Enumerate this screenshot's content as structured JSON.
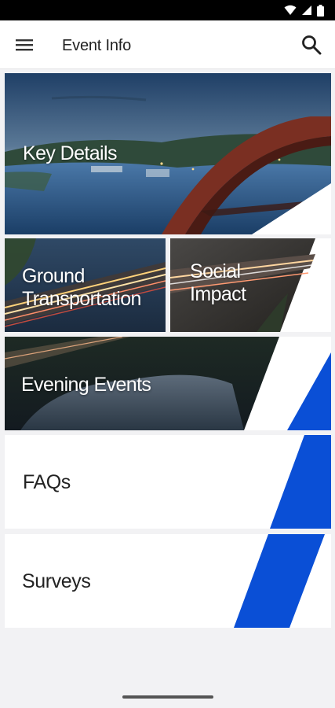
{
  "status_bar": {
    "icons": [
      "wifi-icon",
      "signal-icon",
      "battery-icon"
    ]
  },
  "app_bar": {
    "title": "Event Info",
    "menu_icon": "hamburger-menu-icon",
    "search_icon": "search-icon"
  },
  "tiles": {
    "key_details": "Key Details",
    "ground_line1": "Ground",
    "ground_line2": "Transportation",
    "social_line1": "Social",
    "social_line2": "Impact",
    "evening_events": "Evening Events",
    "faqs": "FAQs",
    "surveys": "Surveys"
  },
  "colors": {
    "accent_blue": "#0a4fd6",
    "background": "#f2f2f4",
    "tile_white": "#ffffff"
  }
}
